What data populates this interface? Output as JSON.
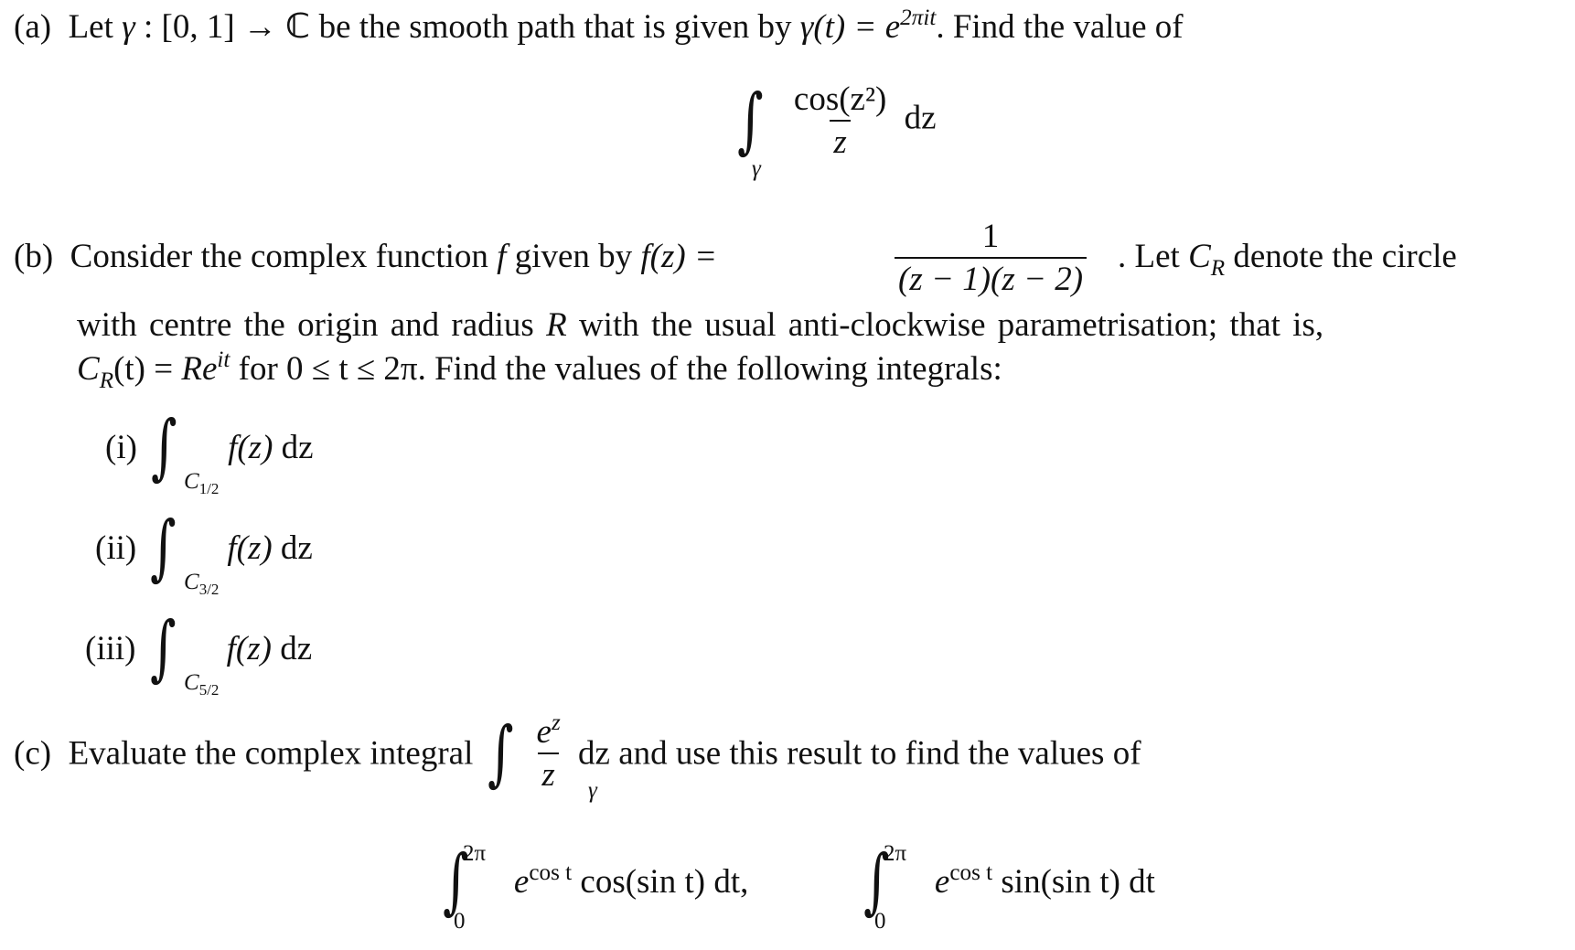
{
  "part_a": {
    "label": "(a)",
    "text_1": "Let",
    "gamma": "γ",
    "domain": ": [0, 1] →",
    "field": "ℂ",
    "text_2": "be the smooth path that is given by",
    "gamma_t": "γ(t) =",
    "e": "e",
    "exponent": "2πit",
    "text_3": ". Find the value of",
    "integral": {
      "sign": "∫",
      "lower": "γ",
      "numerator": "cos(z²)",
      "denominator": "z",
      "differential": "dz"
    }
  },
  "part_b": {
    "label": "(b)",
    "text_1": "Consider the complex function",
    "f": "f",
    "text_2": "given by",
    "f_of_z": "f(z) =",
    "fraction": {
      "numerator": "1",
      "denominator": "(z − 1)(z − 2)"
    },
    "text_3": ".   Let",
    "c_r": "C",
    "c_r_sub": "R",
    "text_4": "denote the circle",
    "line_2_a": "with centre the origin and radius",
    "r": "R",
    "line_2_b": "with the usual anti-clockwise parametrisation; that is,",
    "line_3_cr": "C",
    "line_3_sub": "R",
    "line_3_eq": "(t) =",
    "line_3_re": "Re",
    "line_3_exp": "it",
    "line_3_range": "for 0 ≤ t ≤ 2π",
    "line_3_tail": ". Find the values of the following integrals:",
    "items": [
      {
        "label": "(i)",
        "contour": "C",
        "subscript": "1/2",
        "integrand": "f(z)",
        "differential": "dz"
      },
      {
        "label": "(ii)",
        "contour": "C",
        "subscript": "3/2",
        "integrand": "f(z)",
        "differential": "dz"
      },
      {
        "label": "(iii)",
        "contour": "C",
        "subscript": "5/2",
        "integrand": "f(z)",
        "differential": "dz"
      }
    ]
  },
  "part_c": {
    "label": "(c)",
    "text_1": "Evaluate the complex integral",
    "integral": {
      "lower": "γ",
      "numerator_base": "e",
      "numerator_exp": "z",
      "denominator": "z",
      "differential": "dz"
    },
    "text_2": "and use this result to find the values of",
    "real_integrals": [
      {
        "lower": "0",
        "upper": "2π",
        "base": "e",
        "exp": "cos t",
        "trig": "cos(sin t)",
        "differential": "dt",
        "trail": ","
      },
      {
        "lower": "0",
        "upper": "2π",
        "base": "e",
        "exp": "cos t",
        "trig": "sin(sin t)",
        "differential": "dt",
        "trail": ""
      }
    ]
  }
}
